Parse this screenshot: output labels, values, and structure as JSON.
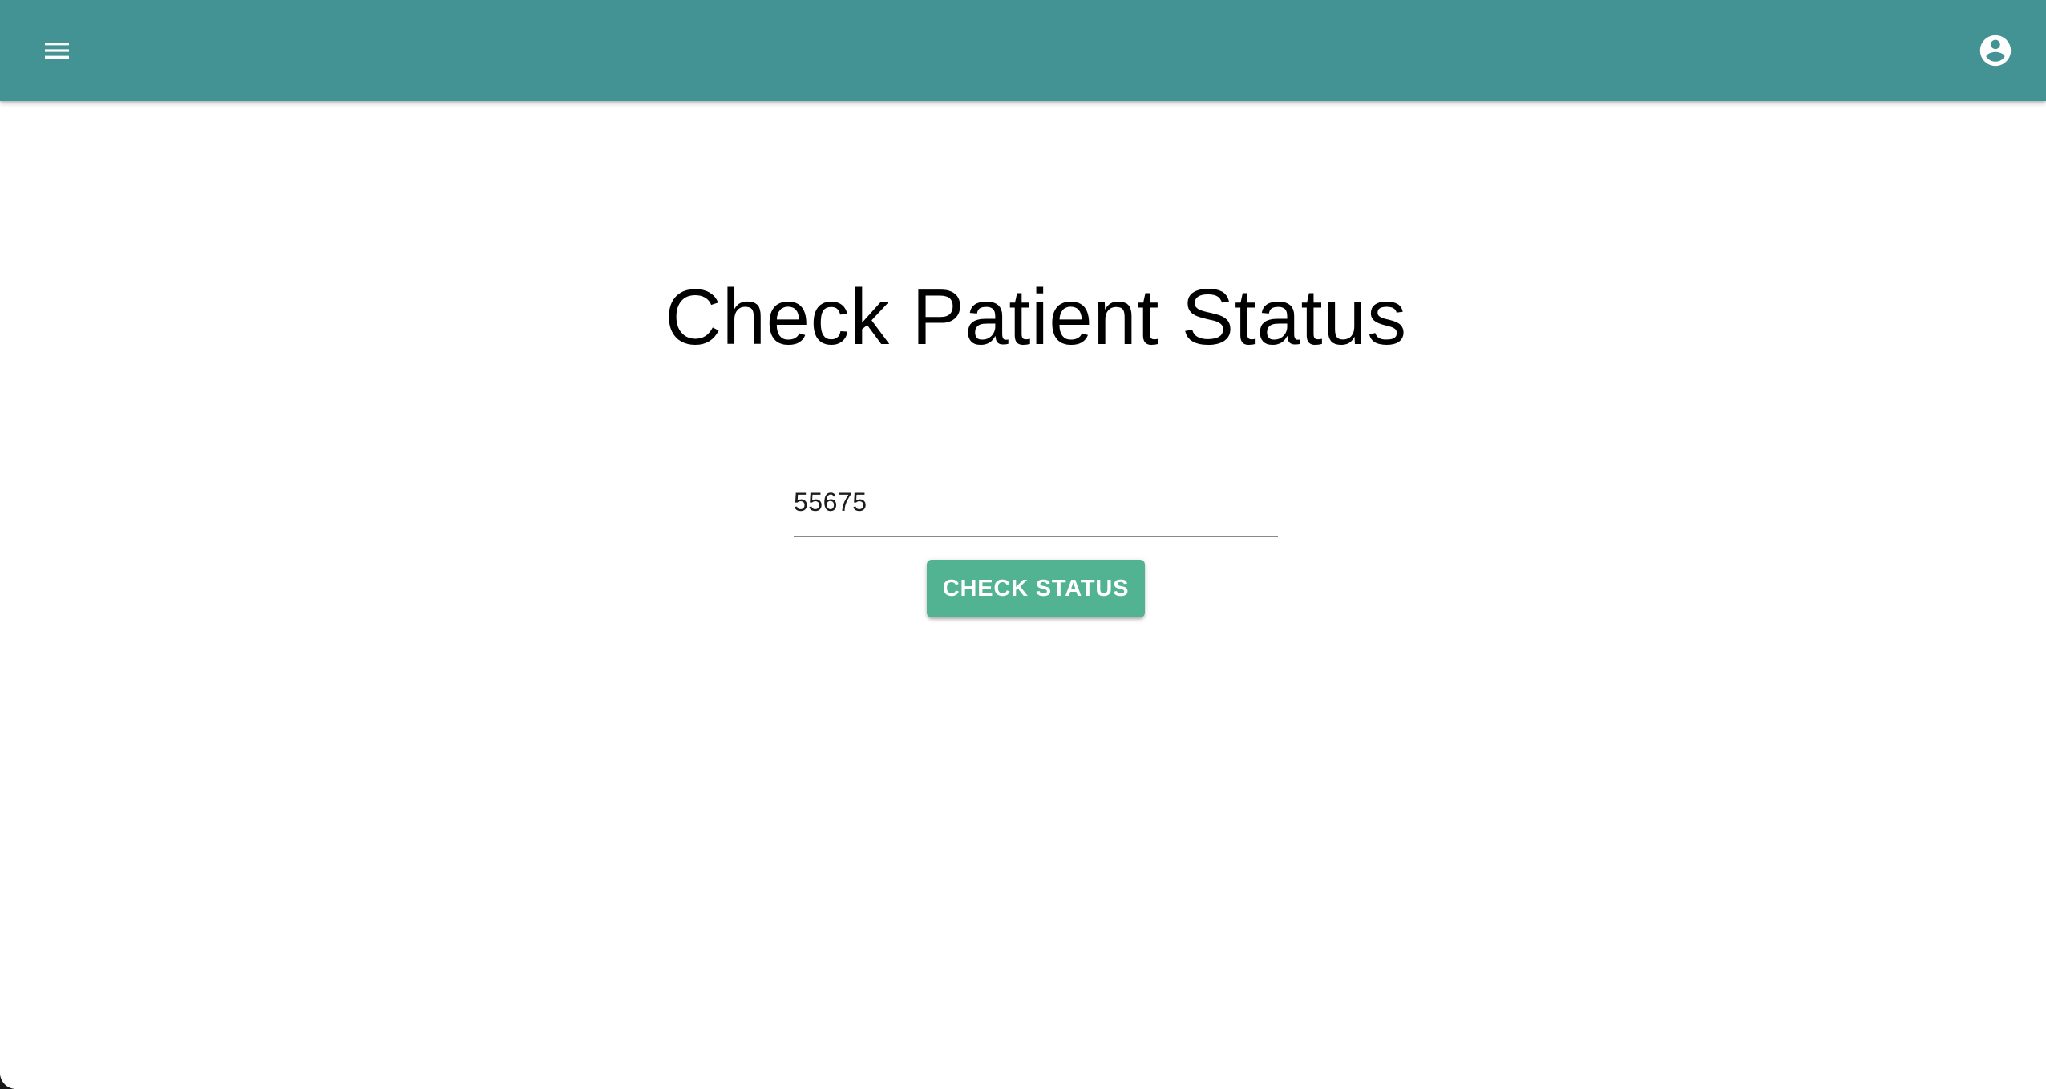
{
  "colors": {
    "app_bar": "#439395",
    "button": "#52b393",
    "icon": "#ffffff"
  },
  "header": {
    "menu_icon": "menu-icon",
    "account_icon": "account-circle-icon"
  },
  "main": {
    "title": "Check Patient Status",
    "patient_id_value": "55675",
    "check_button_label": "CHECK STATUS"
  }
}
